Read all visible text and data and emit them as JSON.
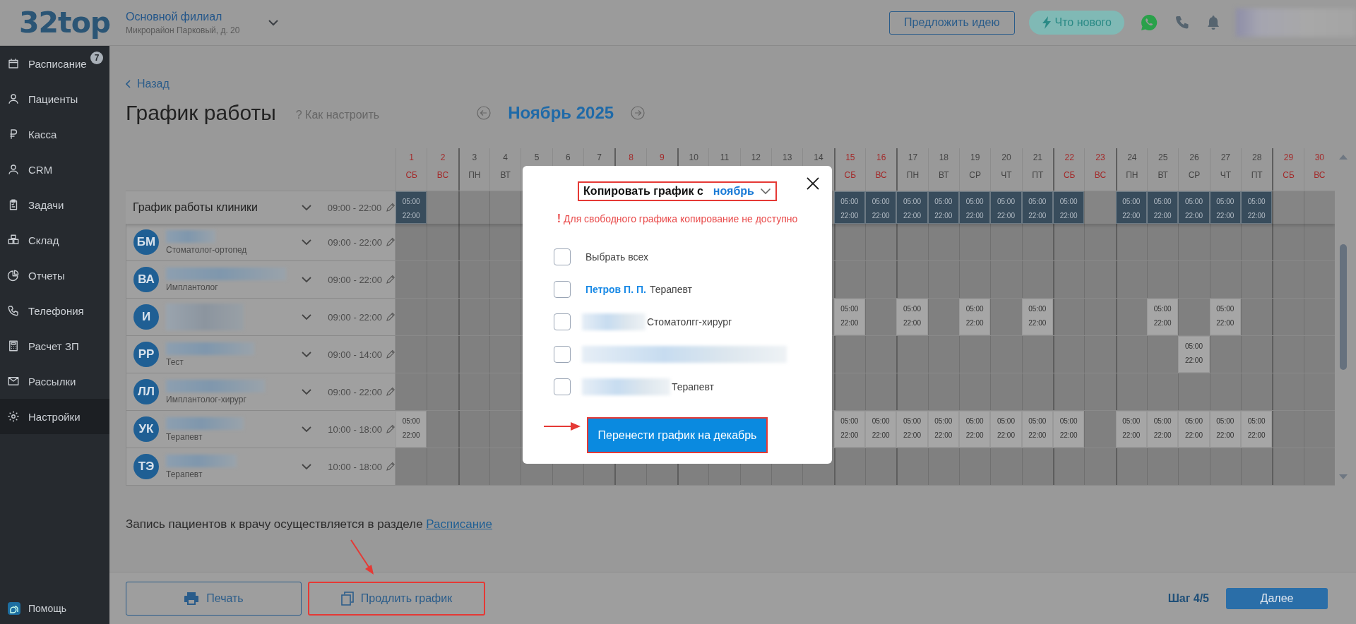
{
  "topbar": {
    "logo": "32top",
    "branch_name": "Основной филиал",
    "branch_address": "Микрорайон Парковый, д. 20",
    "idea_button": "Предложить идею",
    "news_button": "Что нового"
  },
  "sidebar": {
    "items": [
      {
        "label": "Расписание",
        "badge": "7",
        "selected": false
      },
      {
        "label": "Пациенты",
        "selected": false
      },
      {
        "label": "Касса",
        "selected": false
      },
      {
        "label": "CRM",
        "selected": false
      },
      {
        "label": "Задачи",
        "selected": false
      },
      {
        "label": "Склад",
        "selected": false
      },
      {
        "label": "Отчеты",
        "selected": false
      },
      {
        "label": "Телефония",
        "selected": false
      },
      {
        "label": "Расчет ЗП",
        "selected": false
      },
      {
        "label": "Рассылки",
        "selected": false
      },
      {
        "label": "Настройки",
        "selected": true
      }
    ],
    "help": "Помощь"
  },
  "page": {
    "back": "Назад",
    "title": "График работы",
    "how_to": "? Как настроить",
    "month": "Ноябрь 2025"
  },
  "days": [
    {
      "n": "1",
      "wd": "СБ",
      "weekend": true
    },
    {
      "n": "2",
      "wd": "ВС",
      "weekend": true
    },
    {
      "n": "3",
      "wd": "ПН",
      "weekend": false
    },
    {
      "n": "4",
      "wd": "ВТ",
      "weekend": false
    },
    {
      "n": "5",
      "weekend": false
    },
    {
      "n": "6",
      "weekend": false
    },
    {
      "n": "7",
      "weekend": false
    },
    {
      "n": "8",
      "weekend": true
    },
    {
      "n": "9",
      "weekend": true
    },
    {
      "n": "10",
      "weekend": false
    },
    {
      "n": "11",
      "weekend": false
    },
    {
      "n": "12",
      "weekend": false
    },
    {
      "n": "13",
      "weekend": false
    },
    {
      "n": "14",
      "weekend": false
    },
    {
      "n": "15",
      "wd": "СБ",
      "weekend": true
    },
    {
      "n": "16",
      "wd": "ВС",
      "weekend": true
    },
    {
      "n": "17",
      "wd": "ПН",
      "weekend": false
    },
    {
      "n": "18",
      "wd": "ВТ",
      "weekend": false
    },
    {
      "n": "19",
      "wd": "СР",
      "weekend": false
    },
    {
      "n": "20",
      "wd": "ЧТ",
      "weekend": false
    },
    {
      "n": "21",
      "wd": "ПТ",
      "weekend": false
    },
    {
      "n": "22",
      "wd": "СБ",
      "weekend": true
    },
    {
      "n": "23",
      "wd": "ВС",
      "weekend": true
    },
    {
      "n": "24",
      "wd": "ПН",
      "weekend": false
    },
    {
      "n": "25",
      "wd": "ВТ",
      "weekend": false
    },
    {
      "n": "26",
      "wd": "СР",
      "weekend": false
    },
    {
      "n": "27",
      "wd": "ЧТ",
      "weekend": false
    },
    {
      "n": "28",
      "wd": "ПТ",
      "weekend": false
    },
    {
      "n": "29",
      "wd": "СБ",
      "weekend": true
    },
    {
      "n": "30",
      "wd": "ВС",
      "weekend": true
    }
  ],
  "rows": [
    {
      "kind": "clinic",
      "label": "График работы клиники",
      "hours": "09:00 - 22:00",
      "cells": [
        {
          "from": "05:00",
          "to": "22:00"
        },
        null,
        null,
        null,
        null,
        null,
        null,
        null,
        null,
        null,
        null,
        null,
        null,
        null,
        {
          "from": "05:00",
          "to": "22:00"
        },
        {
          "from": "05:00",
          "to": "22:00"
        },
        {
          "from": "05:00",
          "to": "22:00"
        },
        {
          "from": "05:00",
          "to": "22:00"
        },
        {
          "from": "05:00",
          "to": "22:00"
        },
        {
          "from": "05:00",
          "to": "22:00"
        },
        {
          "from": "05:00",
          "to": "22:00"
        },
        {
          "from": "05:00",
          "to": "22:00"
        },
        null,
        {
          "from": "05:00",
          "to": "22:00"
        },
        {
          "from": "05:00",
          "to": "22:00"
        },
        {
          "from": "05:00",
          "to": "22:00"
        },
        {
          "from": "05:00",
          "to": "22:00"
        },
        {
          "from": "05:00",
          "to": "22:00"
        },
        null,
        null
      ]
    },
    {
      "kind": "staff",
      "initials": "БМ",
      "role": "Стоматолог-ортопед",
      "hours": "09:00 - 22:00",
      "cells": [
        null,
        null,
        null,
        null,
        null,
        null,
        null,
        null,
        null,
        null,
        null,
        null,
        null,
        null,
        null,
        null,
        null,
        null,
        null,
        null,
        null,
        null,
        null,
        null,
        null,
        null,
        null,
        null,
        null,
        null
      ]
    },
    {
      "kind": "staff",
      "initials": "ВА",
      "role": "Имплантолог",
      "hours": "09:00 - 22:00",
      "cells": [
        null,
        null,
        null,
        null,
        null,
        null,
        null,
        null,
        null,
        null,
        null,
        null,
        null,
        null,
        null,
        null,
        null,
        null,
        null,
        null,
        null,
        null,
        null,
        null,
        null,
        null,
        null,
        null,
        null,
        null
      ]
    },
    {
      "kind": "staff",
      "initials": "И",
      "hours": "09:00 - 22:00",
      "cells": [
        null,
        null,
        null,
        null,
        null,
        null,
        null,
        null,
        null,
        null,
        null,
        null,
        null,
        null,
        {
          "from": "05:00",
          "to": "22:00"
        },
        null,
        {
          "from": "05:00",
          "to": "22:00"
        },
        null,
        {
          "from": "05:00",
          "to": "22:00"
        },
        null,
        {
          "from": "05:00",
          "to": "22:00"
        },
        null,
        null,
        null,
        {
          "from": "05:00",
          "to": "22:00"
        },
        null,
        {
          "from": "05:00",
          "to": "22:00"
        },
        null,
        null,
        null
      ]
    },
    {
      "kind": "staff",
      "initials": "РР",
      "role": "Тест",
      "hours": "09:00 - 14:00",
      "cells": [
        null,
        null,
        null,
        null,
        null,
        null,
        null,
        null,
        null,
        null,
        null,
        null,
        null,
        null,
        null,
        null,
        null,
        null,
        null,
        null,
        null,
        null,
        null,
        null,
        null,
        {
          "from": "05:00",
          "to": "22:00"
        },
        null,
        null,
        null,
        null
      ]
    },
    {
      "kind": "staff",
      "initials": "ЛЛ",
      "role": "Имплантолог-хирург",
      "hours": "09:00 - 22:00",
      "cells": [
        null,
        null,
        null,
        null,
        null,
        null,
        null,
        null,
        null,
        null,
        null,
        null,
        null,
        null,
        null,
        null,
        null,
        null,
        null,
        null,
        null,
        null,
        null,
        null,
        null,
        null,
        null,
        null,
        null,
        null
      ]
    },
    {
      "kind": "staff",
      "initials": "УК",
      "role": "Терапевт",
      "hours": "10:00 - 18:00",
      "cells": [
        {
          "from": "05:00",
          "to": "22:00"
        },
        null,
        null,
        null,
        null,
        null,
        null,
        null,
        null,
        null,
        null,
        null,
        null,
        null,
        {
          "from": "05:00",
          "to": "22:00"
        },
        {
          "from": "05:00",
          "to": "22:00"
        },
        {
          "from": "05:00",
          "to": "22:00"
        },
        {
          "from": "05:00",
          "to": "22:00"
        },
        {
          "from": "05:00",
          "to": "22:00"
        },
        {
          "from": "05:00",
          "to": "22:00"
        },
        {
          "from": "05:00",
          "to": "22:00"
        },
        {
          "from": "05:00",
          "to": "22:00"
        },
        null,
        {
          "from": "05:00",
          "to": "22:00"
        },
        {
          "from": "05:00",
          "to": "22:00"
        },
        {
          "from": "05:00",
          "to": "22:00"
        },
        {
          "from": "05:00",
          "to": "22:00"
        },
        {
          "from": "05:00",
          "to": "22:00"
        },
        null,
        null
      ]
    },
    {
      "kind": "staff",
      "initials": "ТЭ",
      "role": "Терапевт",
      "hours": "10:00 - 18:00",
      "cells": [
        null,
        null,
        null,
        null,
        null,
        null,
        null,
        null,
        null,
        null,
        null,
        null,
        null,
        null,
        null,
        null,
        null,
        null,
        null,
        null,
        null,
        null,
        null,
        null,
        null,
        null,
        null,
        null,
        null,
        null
      ]
    }
  ],
  "note": {
    "text": "Запись пациентов к врачу осуществляется в разделе ",
    "link": "Расписание"
  },
  "bottom_bar": {
    "print": "Печать",
    "extend": "Продлить график",
    "step": "Шаг 4/5",
    "next": "Далее"
  },
  "copy_dialog": {
    "title": "Копировать график с",
    "month": "ноябрь",
    "warning_mark": "!",
    "warning": "Для свободного графика копирование не доступно",
    "select_all": {
      "label": "Выбрать всех",
      "checked": false
    },
    "employees": [
      {
        "name": "Петров П. П.",
        "role": "Терапевт",
        "checked": false
      },
      {
        "role": "Стоматолгг-хирург",
        "checked": false
      },
      {
        "checked": false
      },
      {
        "role": "Терапевт",
        "checked": false
      }
    ],
    "submit": "Перенести график на декабрь"
  }
}
